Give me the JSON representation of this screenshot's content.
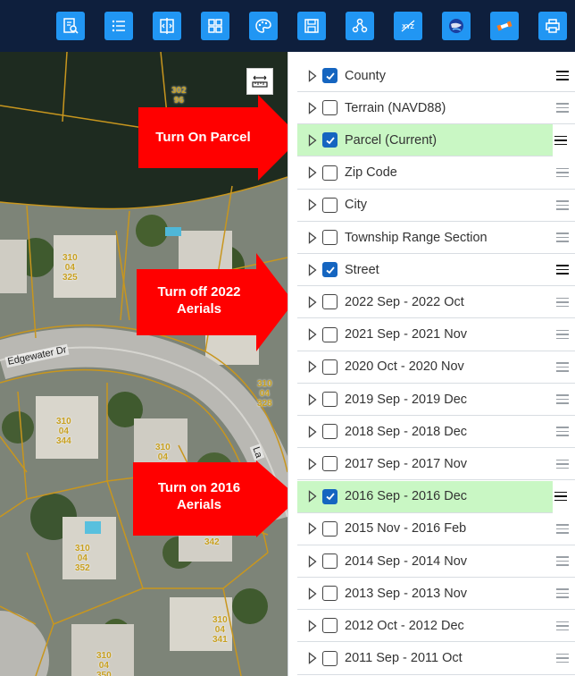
{
  "toolbar": {
    "buttons": [
      {
        "icon": "search-report-icon"
      },
      {
        "icon": "list-icon"
      },
      {
        "icon": "compare-icon"
      },
      {
        "icon": "grid-icon"
      },
      {
        "icon": "palette-icon"
      },
      {
        "icon": "save-icon"
      },
      {
        "icon": "share-icon"
      },
      {
        "icon": "xyz-icon",
        "label": "XYZ"
      },
      {
        "icon": "globe-icon"
      },
      {
        "icon": "satellite-icon"
      },
      {
        "icon": "print-icon"
      }
    ]
  },
  "map": {
    "parcel_labels": [
      "302\n96",
      "310\n04\n325",
      "310\n04\n328",
      "310\n04\n344",
      "310\n04",
      "310\n04\n352",
      "342",
      "310\n04\n341",
      "310\n04\n350"
    ],
    "street_label": "Edgewater Dr",
    "street_label_2": "La"
  },
  "callouts": {
    "parcel": "Turn On Parcel",
    "aerials_2022": "Turn off 2022\nAerials",
    "aerials_2016": "Turn on 2016\nAerials"
  },
  "layers": [
    {
      "name": "County",
      "checked": true,
      "highlight": false,
      "handle_dark": true
    },
    {
      "name": "Terrain (NAVD88)",
      "checked": false,
      "highlight": false,
      "handle_dark": false
    },
    {
      "name": "Parcel (Current)",
      "checked": true,
      "highlight": true,
      "handle_dark": true
    },
    {
      "name": "Zip Code",
      "checked": false,
      "highlight": false,
      "handle_dark": false
    },
    {
      "name": "City",
      "checked": false,
      "highlight": false,
      "handle_dark": false
    },
    {
      "name": "Township Range Section",
      "checked": false,
      "highlight": false,
      "handle_dark": false
    },
    {
      "name": "Street",
      "checked": true,
      "highlight": false,
      "handle_dark": true
    },
    {
      "name": "2022 Sep - 2022 Oct",
      "checked": false,
      "highlight": false,
      "handle_dark": false
    },
    {
      "name": "2021 Sep - 2021 Nov",
      "checked": false,
      "highlight": false,
      "handle_dark": false
    },
    {
      "name": "2020 Oct - 2020 Nov",
      "checked": false,
      "highlight": false,
      "handle_dark": false
    },
    {
      "name": "2019 Sep - 2019 Dec",
      "checked": false,
      "highlight": false,
      "handle_dark": false
    },
    {
      "name": "2018 Sep - 2018 Dec",
      "checked": false,
      "highlight": false,
      "handle_dark": false
    },
    {
      "name": "2017 Sep - 2017 Nov",
      "checked": false,
      "highlight": false,
      "handle_dark": false
    },
    {
      "name": "2016 Sep - 2016 Dec",
      "checked": true,
      "highlight": true,
      "handle_dark": true
    },
    {
      "name": "2015 Nov - 2016 Feb",
      "checked": false,
      "highlight": false,
      "handle_dark": false
    },
    {
      "name": "2014 Sep - 2014 Nov",
      "checked": false,
      "highlight": false,
      "handle_dark": false
    },
    {
      "name": "2013 Sep - 2013 Nov",
      "checked": false,
      "highlight": false,
      "handle_dark": false
    },
    {
      "name": "2012 Oct - 2012 Dec",
      "checked": false,
      "highlight": false,
      "handle_dark": false
    },
    {
      "name": "2011 Sep - 2011 Oct",
      "checked": false,
      "highlight": false,
      "handle_dark": false
    }
  ],
  "colors": {
    "toolbar_bg": "#0e1f3d",
    "button_bg": "#2196f3",
    "highlight_row": "#c9f7c4",
    "checkbox_checked": "#1565c0",
    "callout_arrow": "#ff0000",
    "parcel_line": "#c8961e"
  }
}
